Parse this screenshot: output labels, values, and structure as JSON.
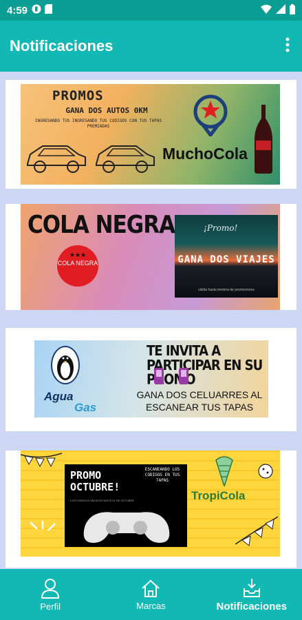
{
  "status_bar": {
    "time": "4:59",
    "icons": [
      "circle-app-icon",
      "sd-card-icon",
      "wifi-icon",
      "signal-icon",
      "battery-icon"
    ]
  },
  "app_bar": {
    "title": "Notificaciones",
    "menu_icon": "more-vert-icon",
    "color": "#12b8b3"
  },
  "notifications": [
    {
      "brand": "MuchoCola",
      "title": "PROMOS",
      "subtitle": "GANA DOS AUTOS 0KM",
      "small_text": "INGRESANDO TUS INGRESANDO TUS CODIGOS CON TUS TAPAS PREMIADAS"
    },
    {
      "brand_title": "COLA NEGRA",
      "badge_text": "COLA NEGRA",
      "promo": "¡Promo!",
      "headline": "GANA DOS VIAJES",
      "fine_print": "válida hasta termina de promociones"
    },
    {
      "brand_part1": "Agua",
      "brand_part2": "Gas",
      "headline": "TE INVITA  A PARTICIPAR EN SU PROMO",
      "body": "GANA DOS CELUARRES AL ESCANEAR TUS TAPAS"
    },
    {
      "title": "PROMO OCTUBRE!",
      "side_text": "ESCANEANDO LOS CODIGOS EN TUS TAPAS",
      "fine_print": "LOS CODIGOS VALIDOS HASTA 31 DE OCTUBRE",
      "brand": "TropiCola"
    }
  ],
  "bottom_nav": [
    {
      "label": "Perfil",
      "icon": "person-icon"
    },
    {
      "label": "Marcas",
      "icon": "home-icon"
    },
    {
      "label": "Notificaciones",
      "icon": "inbox-download-icon",
      "active": true
    }
  ]
}
